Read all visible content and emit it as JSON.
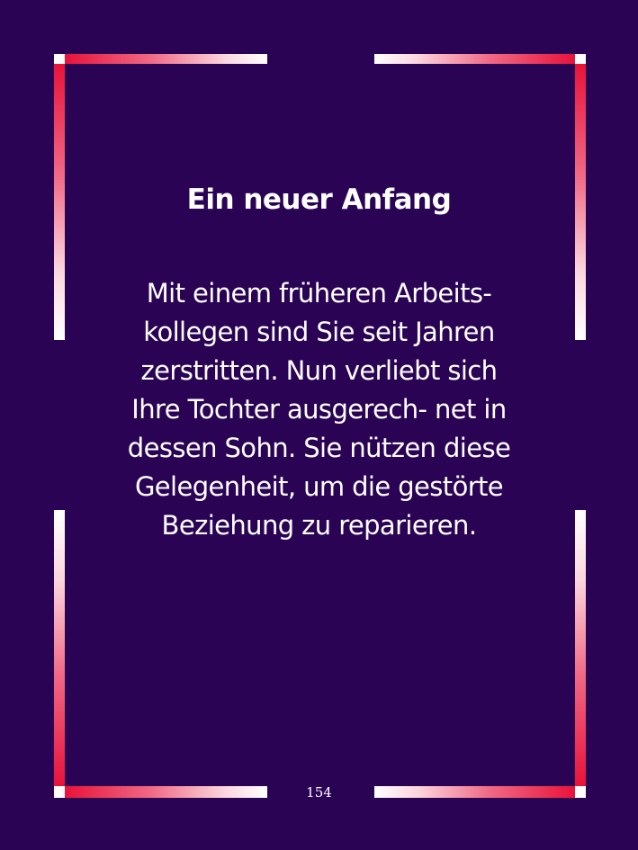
{
  "card": {
    "title": "Ein neuer Anfang",
    "body_lines": [
      " Mit einem früheren Arbeits-",
      "kollegen sind Sie seit Jahren",
      "zerstritten. Nun verliebt sich",
      "Ihre Tochter ausgerech- net in",
      "dessen Sohn. Sie nützen diese",
      "Gelegenheit, um die gestörte",
      "Beziehung zu reparieren."
    ],
    "page_number": "154"
  },
  "colors": {
    "background": "#2a0355",
    "frame_red": "#e8123a",
    "frame_white": "#ffffff",
    "text": "#ffffff"
  }
}
